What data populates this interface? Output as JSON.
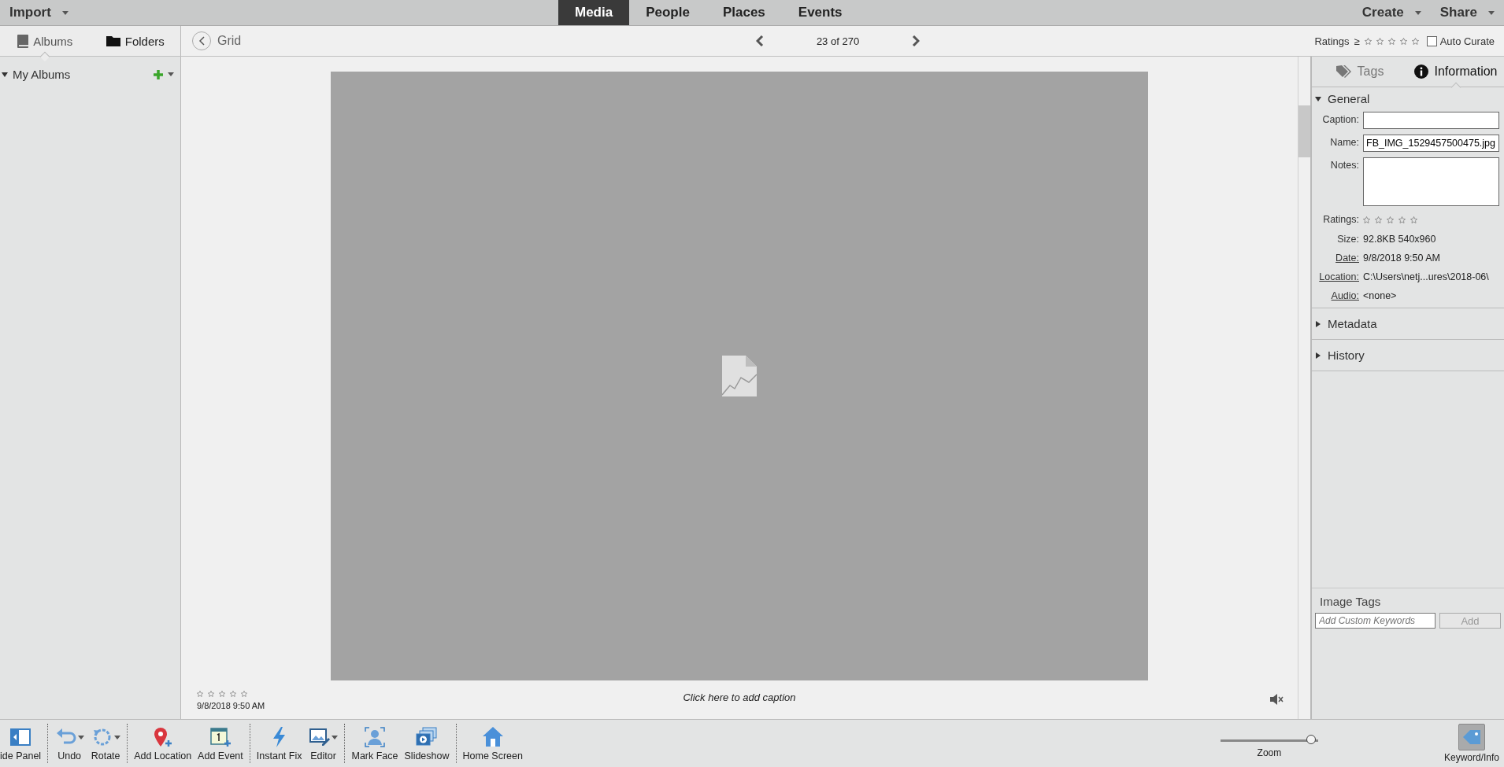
{
  "top_bar": {
    "import": "Import",
    "tabs": [
      {
        "label": "Media",
        "selected": true
      },
      {
        "label": "People",
        "selected": false
      },
      {
        "label": "Places",
        "selected": false
      },
      {
        "label": "Events",
        "selected": false
      }
    ],
    "create": "Create",
    "share": "Share"
  },
  "sidebar": {
    "tabs": [
      {
        "label": "Albums",
        "selected": true
      },
      {
        "label": "Folders",
        "selected": false
      }
    ],
    "section": {
      "label": "My Albums",
      "expanded": true
    }
  },
  "nav_bar": {
    "back": "Grid",
    "counter": "23 of 270",
    "ratings_label": "Ratings",
    "ratings_op": "≥",
    "stars": 0,
    "auto_curate": {
      "label": "Auto Curate",
      "checked": false
    }
  },
  "viewer": {
    "stars": 0,
    "date": "9/8/2018 9:50 AM",
    "caption_prompt": "Click here to add caption"
  },
  "info_panel": {
    "tabs": [
      {
        "label": "Tags",
        "selected": false
      },
      {
        "label": "Information",
        "selected": true
      }
    ],
    "general": {
      "title": "General",
      "expanded": true
    },
    "fields": [
      {
        "label": "Caption:",
        "kind": "input",
        "linked": false
      },
      {
        "label": "Name:",
        "kind": "input",
        "value": "FB_IMG_1529457500475.jpg",
        "linked": false
      },
      {
        "label": "Notes:",
        "kind": "textarea",
        "linked": false
      },
      {
        "label": "Ratings:",
        "kind": "stars",
        "stars": 0,
        "linked": false
      },
      {
        "label": "Size:",
        "kind": "text",
        "value": "92.8KB  540x960",
        "linked": false
      },
      {
        "label": "Date:",
        "kind": "text",
        "value": "9/8/2018 9:50 AM",
        "linked": true
      },
      {
        "label": "Location:",
        "kind": "text",
        "value": "C:\\Users\\netj...ures\\2018-06\\",
        "linked": true
      },
      {
        "label": "Audio:",
        "kind": "text",
        "value": "<none>",
        "linked": true
      }
    ],
    "sections": [
      {
        "title": "Metadata",
        "expanded": false
      },
      {
        "title": "History",
        "expanded": false
      }
    ],
    "image_tags": {
      "title": "Image Tags",
      "placeholder": "Add Custom Keywords",
      "button": "Add",
      "disabled": true
    }
  },
  "toolbar": {
    "items": [
      {
        "label": "ide Panel",
        "menu": false,
        "separator_after": true
      },
      {
        "label": "Undo",
        "menu": true,
        "separator_after": false
      },
      {
        "label": "Rotate",
        "menu": true,
        "separator_after": true
      },
      {
        "label": "Add Location",
        "menu": false,
        "separator_after": false
      },
      {
        "label": "Add Event",
        "menu": false,
        "separator_after": true
      },
      {
        "label": "Instant Fix",
        "menu": false,
        "separator_after": false
      },
      {
        "label": "Editor",
        "menu": true,
        "separator_after": true
      },
      {
        "label": "Mark Face",
        "menu": false,
        "separator_after": false
      },
      {
        "label": "Slideshow",
        "menu": false,
        "separator_after": true
      },
      {
        "label": "Home Screen",
        "menu": false,
        "separator_after": false
      }
    ],
    "zoom": {
      "label": "Zoom",
      "level": 0.97
    },
    "keyword_info": {
      "label": "Keyword/Info",
      "selected": true
    }
  }
}
